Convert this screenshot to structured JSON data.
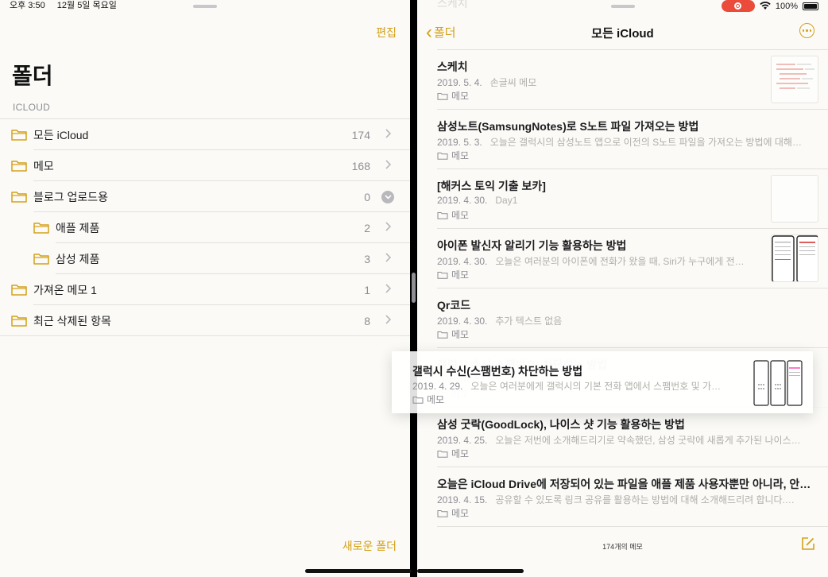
{
  "status_bar": {
    "time": "오후 3:50",
    "date": "12월 5일 목요일",
    "battery": "100%"
  },
  "folders_pane": {
    "edit_label": "편집",
    "title": "폴더",
    "section": "ICLOUD",
    "folders": [
      {
        "name": "모든 iCloud",
        "count": "174",
        "indent": false,
        "expanded": false
      },
      {
        "name": "메모",
        "count": "168",
        "indent": false,
        "expanded": false
      },
      {
        "name": "블로그 업로드용",
        "count": "0",
        "indent": false,
        "expanded": true
      },
      {
        "name": "애플 제품",
        "count": "2",
        "indent": true,
        "expanded": false
      },
      {
        "name": "삼성 제품",
        "count": "3",
        "indent": true,
        "expanded": false
      },
      {
        "name": "가져온 메모 1",
        "count": "1",
        "indent": false,
        "expanded": false
      },
      {
        "name": "최근 삭제된 항목",
        "count": "8",
        "indent": false,
        "expanded": false
      }
    ],
    "new_folder_label": "새로운 폴더"
  },
  "notes_pane": {
    "back_label": "폴더",
    "title": "모든 iCloud",
    "ghost_text": "스케치",
    "notes": [
      {
        "title": "스케치",
        "date": "2019. 5. 4.",
        "preview": "손글씨 메모",
        "folder": "메모",
        "thumb": "sketch"
      },
      {
        "title": "삼성노트(SamsungNotes)로 S노트 파일 가져오는 방법",
        "date": "2019. 5. 3.",
        "preview": "오늘은 갤럭시의 삼성노트 앱으로 이전의 S노트 파일을 가져오는 방법에 대해…",
        "folder": "메모",
        "thumb": ""
      },
      {
        "title": "[해커스 토익 기출 보카]",
        "date": "2019. 4. 30.",
        "preview": "Day1",
        "folder": "메모",
        "thumb": "blank"
      },
      {
        "title": "아이폰 발신자 알리기 기능 활용하는 방법",
        "date": "2019. 4. 30.",
        "preview": "오늘은 여러분의 아이폰에 전화가 왔을 때, Siri가 누구에게 전…",
        "folder": "메모",
        "thumb": "phones"
      },
      {
        "title": "Qr코드",
        "date": "2019. 4. 30.",
        "preview": "추가 텍스트 없음",
        "folder": "메모",
        "thumb": ""
      },
      {
        "title": "갤럭시 수신(스팸번호) 차단하는 방법",
        "date": "2019. 4. 29.",
        "preview": "",
        "folder": "메모",
        "thumb": "",
        "placeholder": true
      },
      {
        "title": "삼성 굿락(GoodLock), 나이스 샷 기능 활용하는 방법",
        "date": "2019. 4. 25.",
        "preview": "오늘은 저번에 소개해드리기로 약속했던, 삼성 굿락에 새롭게 추가된 나이스…",
        "folder": "메모",
        "thumb": "",
        "wide": true
      },
      {
        "title": "오늘은 iCloud Drive에 저장되어 있는 파일을 애플 제품 사용자뿐만 아니라, 안…",
        "date": "2019. 4. 15.",
        "preview": "공유할 수 있도록 링크 공유를 활용하는 방법에 대해 소개해드리려 합니다.…",
        "folder": "메모",
        "thumb": "",
        "wide": true
      }
    ],
    "dragged_note": {
      "title": "갤럭시 수신(스팸번호) 차단하는 방법",
      "date": "2019. 4. 29.",
      "preview": "오늘은 여러분에게 갤럭시의 기본 전화 앱에서 스팸번호 및 가…",
      "folder": "메모"
    },
    "count_label": "174개의 메모"
  },
  "colors": {
    "accent": "#d3a118",
    "background": "#fbfaf7",
    "separator": "#e2e1dc",
    "secondary_text": "#8e8e93",
    "record": "#ea4b3b"
  }
}
